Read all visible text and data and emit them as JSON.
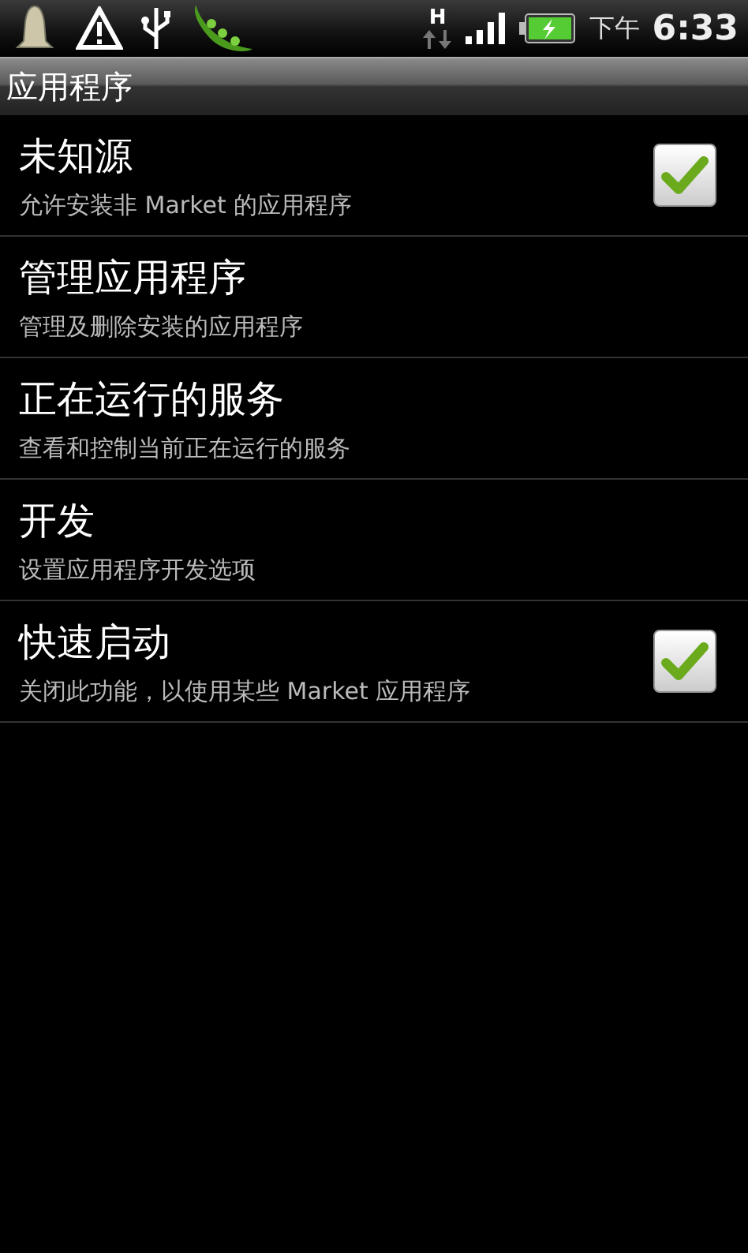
{
  "status_bar": {
    "network_type": "H",
    "period": "下午",
    "time": "6:33"
  },
  "title_bar": {
    "title": "应用程序"
  },
  "items": [
    {
      "kind": "checkbox",
      "title": "未知源",
      "summary": "允许安装非 Market 的应用程序",
      "checked": true
    },
    {
      "kind": "plain",
      "title": "管理应用程序",
      "summary": "管理及删除安装的应用程序"
    },
    {
      "kind": "plain",
      "title": "正在运行的服务",
      "summary": "查看和控制当前正在运行的服务"
    },
    {
      "kind": "plain",
      "title": "开发",
      "summary": "设置应用程序开发选项"
    },
    {
      "kind": "checkbox",
      "title": "快速启动",
      "summary": "关闭此功能，以使用某些 Market 应用程序",
      "checked": true
    }
  ]
}
